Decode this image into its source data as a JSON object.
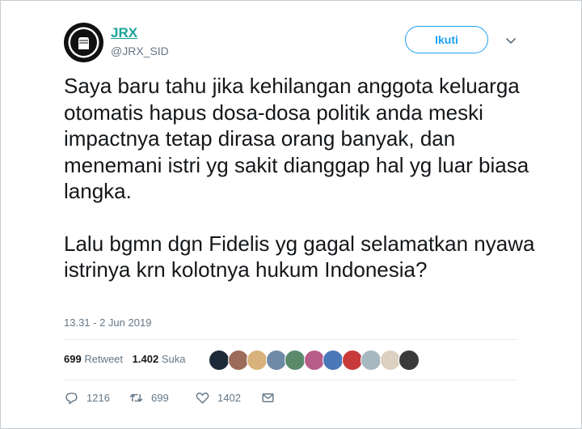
{
  "author": {
    "display_name": "JRX",
    "handle": "@JRX_SID",
    "avatar_text_top": "TOLAK REKLAMASI",
    "avatar_text_bottom": "TELUK BENOA"
  },
  "follow_button_label": "Ikuti",
  "tweet": {
    "paragraph1": "Saya baru tahu jika kehilangan anggota keluarga otomatis hapus dosa-dosa politik anda meski impactnya tetap dirasa orang banyak, dan menemani istri yg sakit dianggap hal yg luar biasa langka.",
    "paragraph2": "Lalu bgmn dgn Fidelis yg gagal selamatkan nyawa istrinya krn kolotnya hukum Indonesia?",
    "timestamp": "13.31 - 2 Jun 2019"
  },
  "stats": {
    "retweet_count": "699",
    "retweet_label": "Retweet",
    "like_count": "1.402",
    "like_label": "Suka"
  },
  "liker_avatar_colors": [
    "#1e2a38",
    "#9c6b5a",
    "#d8b27a",
    "#6e8aa6",
    "#5a8a6a",
    "#b85c8a",
    "#4b78b8",
    "#c83a3a",
    "#a8b8c0",
    "#dcd0c0",
    "#3a3a3a"
  ],
  "actions": {
    "reply_count": "1216",
    "retweet_count": "699",
    "like_count": "1402"
  },
  "colors": {
    "accent": "#1da1f2",
    "name": "#1aa39a",
    "muted": "#657786"
  }
}
